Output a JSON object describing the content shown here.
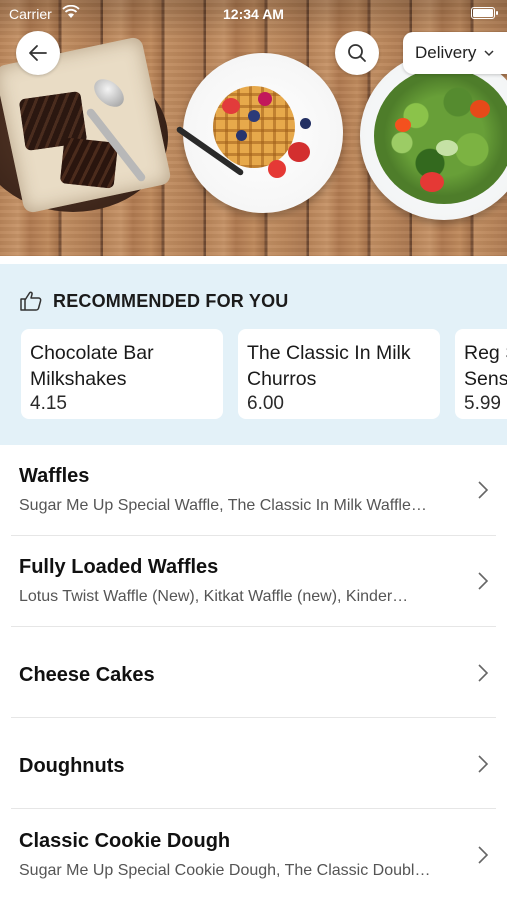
{
  "status_bar": {
    "carrier": "Carrier",
    "time": "12:34 AM"
  },
  "header": {
    "delivery_label": "Delivery"
  },
  "recommended": {
    "title": "RECOMMENDED FOR YOU",
    "items": [
      {
        "name_line1": "Chocolate Bar",
        "name_line2": "Milkshakes",
        "price": "4.15"
      },
      {
        "name_line1": "The Classic In Milk",
        "name_line2": "Churros",
        "price": "6.00"
      },
      {
        "name_line1": "Reg S",
        "name_line2": "Sens",
        "price": "5.99"
      }
    ]
  },
  "categories": [
    {
      "title": "Waffles",
      "subtitle": "Sugar Me Up Special Waffle, The Classic In Milk Waffle…"
    },
    {
      "title": "Fully Loaded Waffles",
      "subtitle": "Lotus Twist Waffle (New), Kitkat Waffle (new), Kinder…"
    },
    {
      "title": "Cheese Cakes",
      "subtitle": ""
    },
    {
      "title": "Doughnuts",
      "subtitle": ""
    },
    {
      "title": "Classic Cookie Dough",
      "subtitle": "Sugar Me Up Special Cookie Dough, The Classic Doubl…"
    }
  ],
  "colors": {
    "recommended_bg": "#e3f1f8",
    "card_bg": "#ffffff",
    "text": "#111111",
    "subtext": "#555555"
  },
  "icons": [
    "back-arrow-icon",
    "search-icon",
    "chevron-down-icon",
    "thumbs-up-icon",
    "chevron-right-icon",
    "wifi-icon",
    "battery-icon"
  ]
}
